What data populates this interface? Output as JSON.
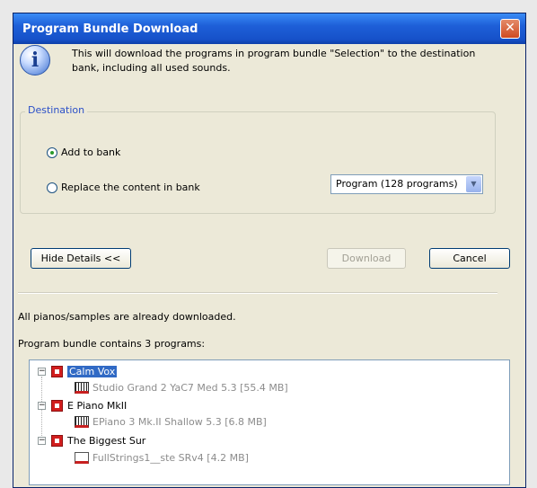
{
  "window": {
    "title": "Program Bundle Download",
    "close": "✕"
  },
  "info": {
    "icon": "info-icon",
    "glyph": "i",
    "message": "This will download the programs in program bundle \"Selection\" to the destination bank, including all used sounds."
  },
  "destination": {
    "legend": "Destination",
    "option_add": "Add to bank",
    "option_replace": "Replace the content in bank",
    "selected": "add",
    "bank_select": "Program (128 programs)"
  },
  "buttons": {
    "hide_details": "Hide Details <<",
    "download": "Download",
    "cancel": "Cancel"
  },
  "status": {
    "line1": "All pianos/samples are already downloaded.",
    "line2": "Program bundle contains 3 programs:"
  },
  "tree": {
    "programs": [
      {
        "name": "Calm Vox",
        "selected": true,
        "sample": "Studio Grand 2 YaC7  Med 5.3 [55.4 MB]",
        "sample_icon": "piano-icon"
      },
      {
        "name": "E Piano MkII",
        "selected": false,
        "sample": "EPiano 3   Mk.II Shallow 5.3 [6.8 MB]",
        "sample_icon": "piano-icon"
      },
      {
        "name": "The Biggest Sur",
        "selected": false,
        "sample": "FullStrings1__ste SRv4 [4.2 MB]",
        "sample_icon": "strings-icon"
      }
    ]
  },
  "colors": {
    "titlebar": "#1651c9",
    "selection": "#316ac5",
    "program_icon": "#d21e1e",
    "legend_text": "#2b50c8"
  }
}
